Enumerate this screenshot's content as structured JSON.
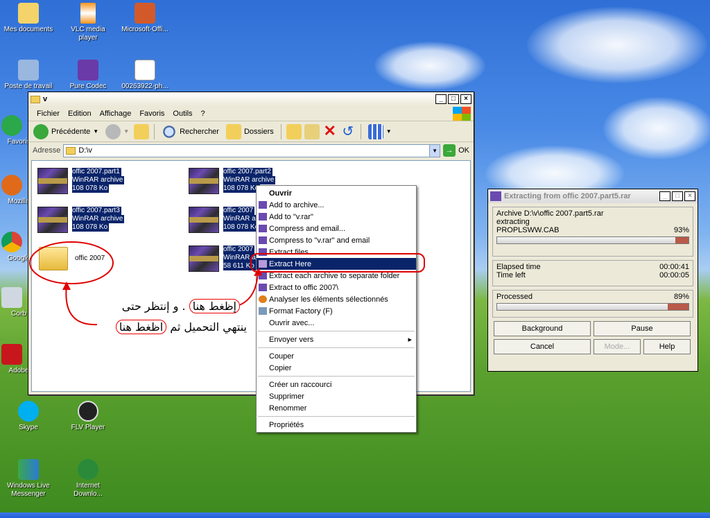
{
  "desktop": {
    "icons": [
      {
        "label": "Mes documents",
        "icon": "my-documents-icon"
      },
      {
        "label": "VLC media player",
        "icon": "vlc-icon"
      },
      {
        "label": "Microsoft-Offi...",
        "icon": "office-installer-icon"
      },
      {
        "label": "Poste de travail",
        "icon": "my-computer-icon"
      },
      {
        "label": "Pure Codec",
        "icon": "pure-codec-icon"
      },
      {
        "label": "00263922-ph...",
        "icon": "image-file-icon"
      },
      {
        "label": "Favoris",
        "icon": "favorites-icon"
      },
      {
        "label": "Mozilla",
        "icon": "firefox-icon"
      },
      {
        "label": "Google",
        "icon": "chrome-icon"
      },
      {
        "label": "Corb",
        "icon": "recycle-bin-icon"
      },
      {
        "label": "Adobe",
        "icon": "adobe-reader-icon"
      },
      {
        "label": "Skype",
        "icon": "skype-icon"
      },
      {
        "label": "FLV Player",
        "icon": "flv-player-icon"
      },
      {
        "label": "Windows Live Messenger",
        "icon": "messenger-icon"
      },
      {
        "label": "Internet Downlo...",
        "icon": "idm-icon"
      }
    ]
  },
  "explorer": {
    "title": "v",
    "menu": [
      "Fichier",
      "Edition",
      "Affichage",
      "Favoris",
      "Outils",
      "?"
    ],
    "toolbar": {
      "back": "Précédente",
      "search": "Rechercher",
      "folders": "Dossiers"
    },
    "address_label": "Adresse",
    "address_value": "D:\\v",
    "go_label": "OK",
    "files": [
      {
        "name": "offic 2007.part1",
        "type": "WinRAR archive",
        "size": "108 078 Ko"
      },
      {
        "name": "offic 2007.part2",
        "type": "WinRAR archive",
        "size": "108 078 Ko"
      },
      {
        "name": "offic 2007.part3",
        "type": "WinRAR archive",
        "size": "108 078 Ko"
      },
      {
        "name": "offic 2007",
        "type": "WinRAR a",
        "size": "108 078 Ko"
      },
      {
        "name": "offic 2007",
        "type": "WinRAR a",
        "size": "58 611 Ko"
      }
    ],
    "folder_name": "offic 2007"
  },
  "context_menu": {
    "items_top": [
      "Ouvrir",
      "Add to archive...",
      "Add to \"v.rar\"",
      "Compress and email...",
      "Compress to \"v.rar\" and email",
      "Extract files...",
      "Extract Here",
      "Extract each archive to separate folder",
      "Extract to offic 2007\\",
      "Analyser les éléments sélectionnés",
      "Format Factory (F)",
      "Ouvrir avec..."
    ],
    "send_to": "Envoyer vers",
    "edit_items": [
      "Couper",
      "Copier"
    ],
    "link_items": [
      "Créer un raccourci",
      "Supprimer",
      "Renommer"
    ],
    "properties": "Propriétés"
  },
  "winrar_progress": {
    "title": "Extracting from offic 2007.part5.rar",
    "archive_line": "Archive D:\\v\\offic 2007.part5.rar",
    "action": "extracting",
    "current_file": "PROPLSWW.CAB",
    "file_percent": "93%",
    "file_progress": 0.93,
    "elapsed_label": "Elapsed time",
    "elapsed_value": "00:00:41",
    "left_label": "Time left",
    "left_value": "00:00:05",
    "processed_label": "Processed",
    "processed_percent": "89%",
    "processed_progress": 0.89,
    "buttons": {
      "background": "Background",
      "pause": "Pause",
      "cancel": "Cancel",
      "mode": "Mode...",
      "help": "Help"
    }
  },
  "annotation": {
    "line1_pill": "إظغط هنا",
    "line1_rest": ". و إنتظر حتى",
    "line2_rest": "ينتهي التحميل ثم",
    "line2_pill": "اظغط هنا"
  },
  "colors": {
    "selection": "#0a246a",
    "annotation_red": "#e00000"
  }
}
